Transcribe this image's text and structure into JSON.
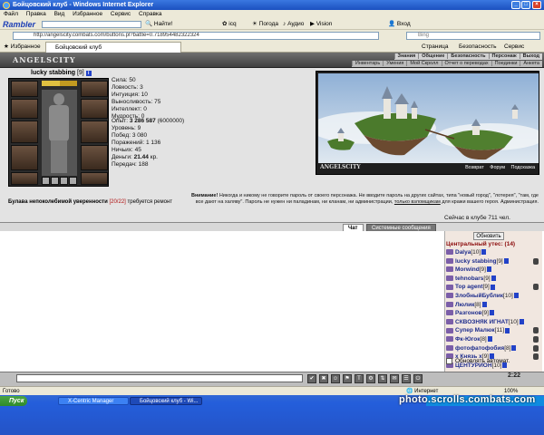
{
  "window": {
    "title": "Бойцовский клуб - Windows Internet Explorer"
  },
  "menu": [
    "Файл",
    "Правка",
    "Вид",
    "Избранное",
    "Сервис",
    "Справка"
  ],
  "toolbar": {
    "brand": "Rambler",
    "find": "Найти!",
    "icq": "icq",
    "weather": "Погода",
    "audio": "Аудио",
    "vision": "Vision",
    "login": "Вход"
  },
  "address": {
    "url": "http://angelscity.combats.com/buttons.pl?battle=0.718954482322324",
    "search_placeholder": "Bing"
  },
  "tabs": {
    "favorites": "Избранное",
    "current": "Бойцовский клуб",
    "page": "Страница",
    "security": "Безопасность",
    "service": "Сервис"
  },
  "game": {
    "logo": "ANGELSCITY",
    "nav_top": [
      "Знания",
      "Общение",
      "Безопасность",
      "Персонаж",
      "Выход"
    ],
    "nav_bottom": [
      "Инвентарь",
      "Умения",
      "Мой Скролл",
      "Отчет о переводах",
      "Поединки",
      "Анкета"
    ],
    "character": {
      "name": "lucky stabbing",
      "level": "[9]",
      "hp": "200/244"
    },
    "stats": [
      "Сила: 50",
      "Ловкость: 3",
      "Интуиция: 10",
      "Выносливость: 75",
      "Интеллект: 0",
      "Мудрость: 0"
    ],
    "progress": {
      "exp_label": "Опыт:",
      "exp_value": "3 286 587",
      "exp_next": "(6000000)",
      "level": "Уровень: 9",
      "wins": "Побед: 3 080",
      "losses": "Поражений: 1 136",
      "draws": "Ничьих: 45",
      "money_label": "Деньги:",
      "money_value": "21.44",
      "money_unit": "кр.",
      "transfers": "Передач: 188"
    },
    "item": {
      "name": "Булава непоколебимой уверенности",
      "durability": "[20/22]",
      "note": "требуется ремонт"
    },
    "scene": {
      "logo": "ANGELSCITY",
      "links": [
        "Возврат",
        "Форум",
        "Подсказка"
      ]
    },
    "warning": {
      "bold": "Внимание!",
      "text": "Никогда и никому не говорите пароль от своего персонажа. Не вводите пароль на других сайтах, типа \"новый город\", \"лотерея\", \"там, где все дают на халяву\". Пароль не нужен ни паладинам, ни кланам, ни администрации,",
      "link": "только взломщикам",
      "tail": "для кражи вашего героя.",
      "sign": "Администрация."
    },
    "online": "Сейчас в клубе 711 чел."
  },
  "chat": {
    "tab_chat": "Чат",
    "tab_system": "Системные сообщения"
  },
  "right_panel": {
    "refresh": "Обновить",
    "location": "Центральный утес: (14)",
    "players": [
      {
        "name": "Dalya",
        "level": "[10]"
      },
      {
        "name": "lucky stabbing",
        "level": "[9]"
      },
      {
        "name": "Morwind",
        "level": "[9]"
      },
      {
        "name": "tehnobars",
        "level": "[9]"
      },
      {
        "name": "Top agent",
        "level": "[9]"
      },
      {
        "name": "ЗлобныйБублик",
        "level": "[10]"
      },
      {
        "name": "Люлик",
        "level": "[8]"
      },
      {
        "name": "Разгонов",
        "level": "[9]"
      },
      {
        "name": "СКВОЗНЯК ИГНАТ",
        "level": "[10]"
      },
      {
        "name": "Супер Малюк",
        "level": "[11]"
      },
      {
        "name": "Фк-Югок",
        "level": "[8]"
      },
      {
        "name": "фотофатофобия",
        "level": "[8]"
      },
      {
        "name": "х Князь х",
        "level": "[9]"
      },
      {
        "name": "ЦЕНТУРИОН",
        "level": "[10]"
      }
    ],
    "auto_refresh": "Обновлять автомат."
  },
  "clock": "2:22",
  "status": {
    "left": "Готово",
    "zone": "Интернет",
    "zoom": "100%"
  },
  "taskbar": {
    "start": "Пуск",
    "task1": "X-Centric Manager",
    "task2": "Бойцовский клуб - Wi..."
  },
  "watermark": "photo.scrolls.combats.com"
}
